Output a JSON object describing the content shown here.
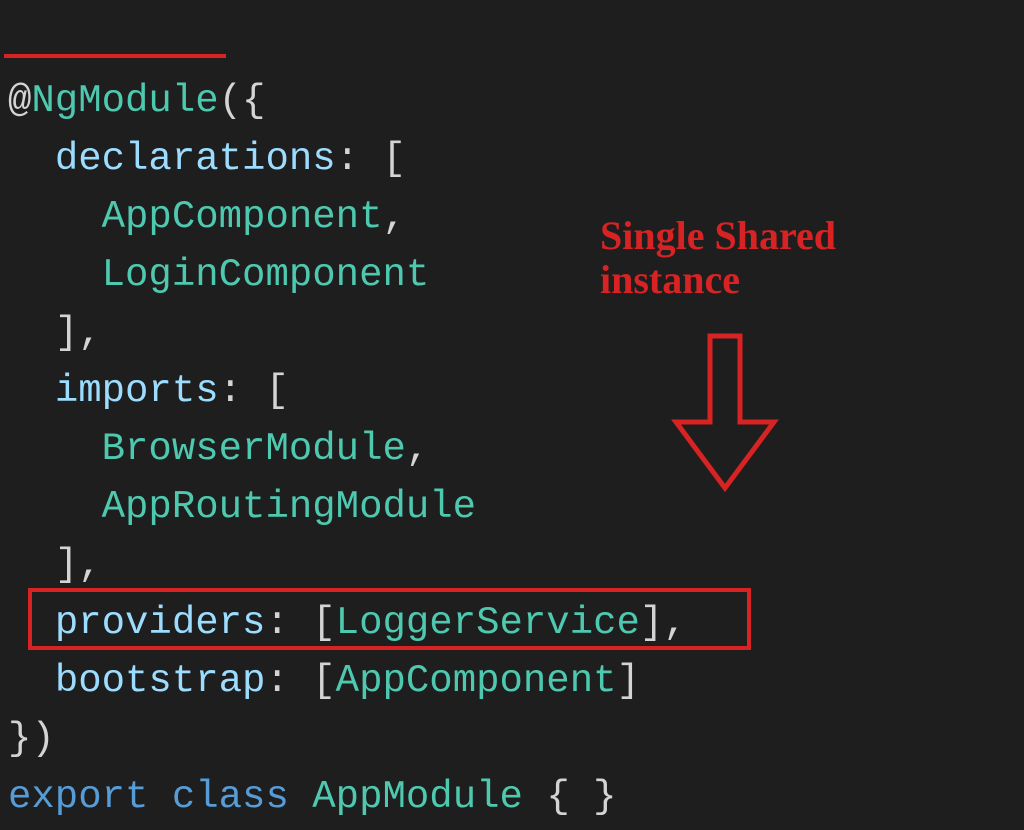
{
  "code": {
    "decoratorAt": "@",
    "decoratorName": "NgModule",
    "openParenBrace": "({",
    "declKey": "declarations",
    "colonBracket": ": [",
    "declItem1": "AppComponent",
    "comma": ",",
    "declItem2": "LoginComponent",
    "closeBracketComma": "],",
    "importsKey": "imports",
    "impItem1": "BrowserModule",
    "impItem2": "AppRoutingModule",
    "providersKey": "providers",
    "colonBracket2": ": [",
    "providerItem": "LoggerService",
    "closeBracketComma2": "],",
    "bootstrapKey": "bootstrap",
    "bootstrapItem": "AppComponent",
    "closeBracket": "]",
    "closeBraceParen": "})",
    "exportKw": "export",
    "classKw": "class",
    "className": "AppModule",
    "emptyBraces": "{ }"
  },
  "annotation": {
    "line1": "Single Shared",
    "line2": "instance"
  }
}
